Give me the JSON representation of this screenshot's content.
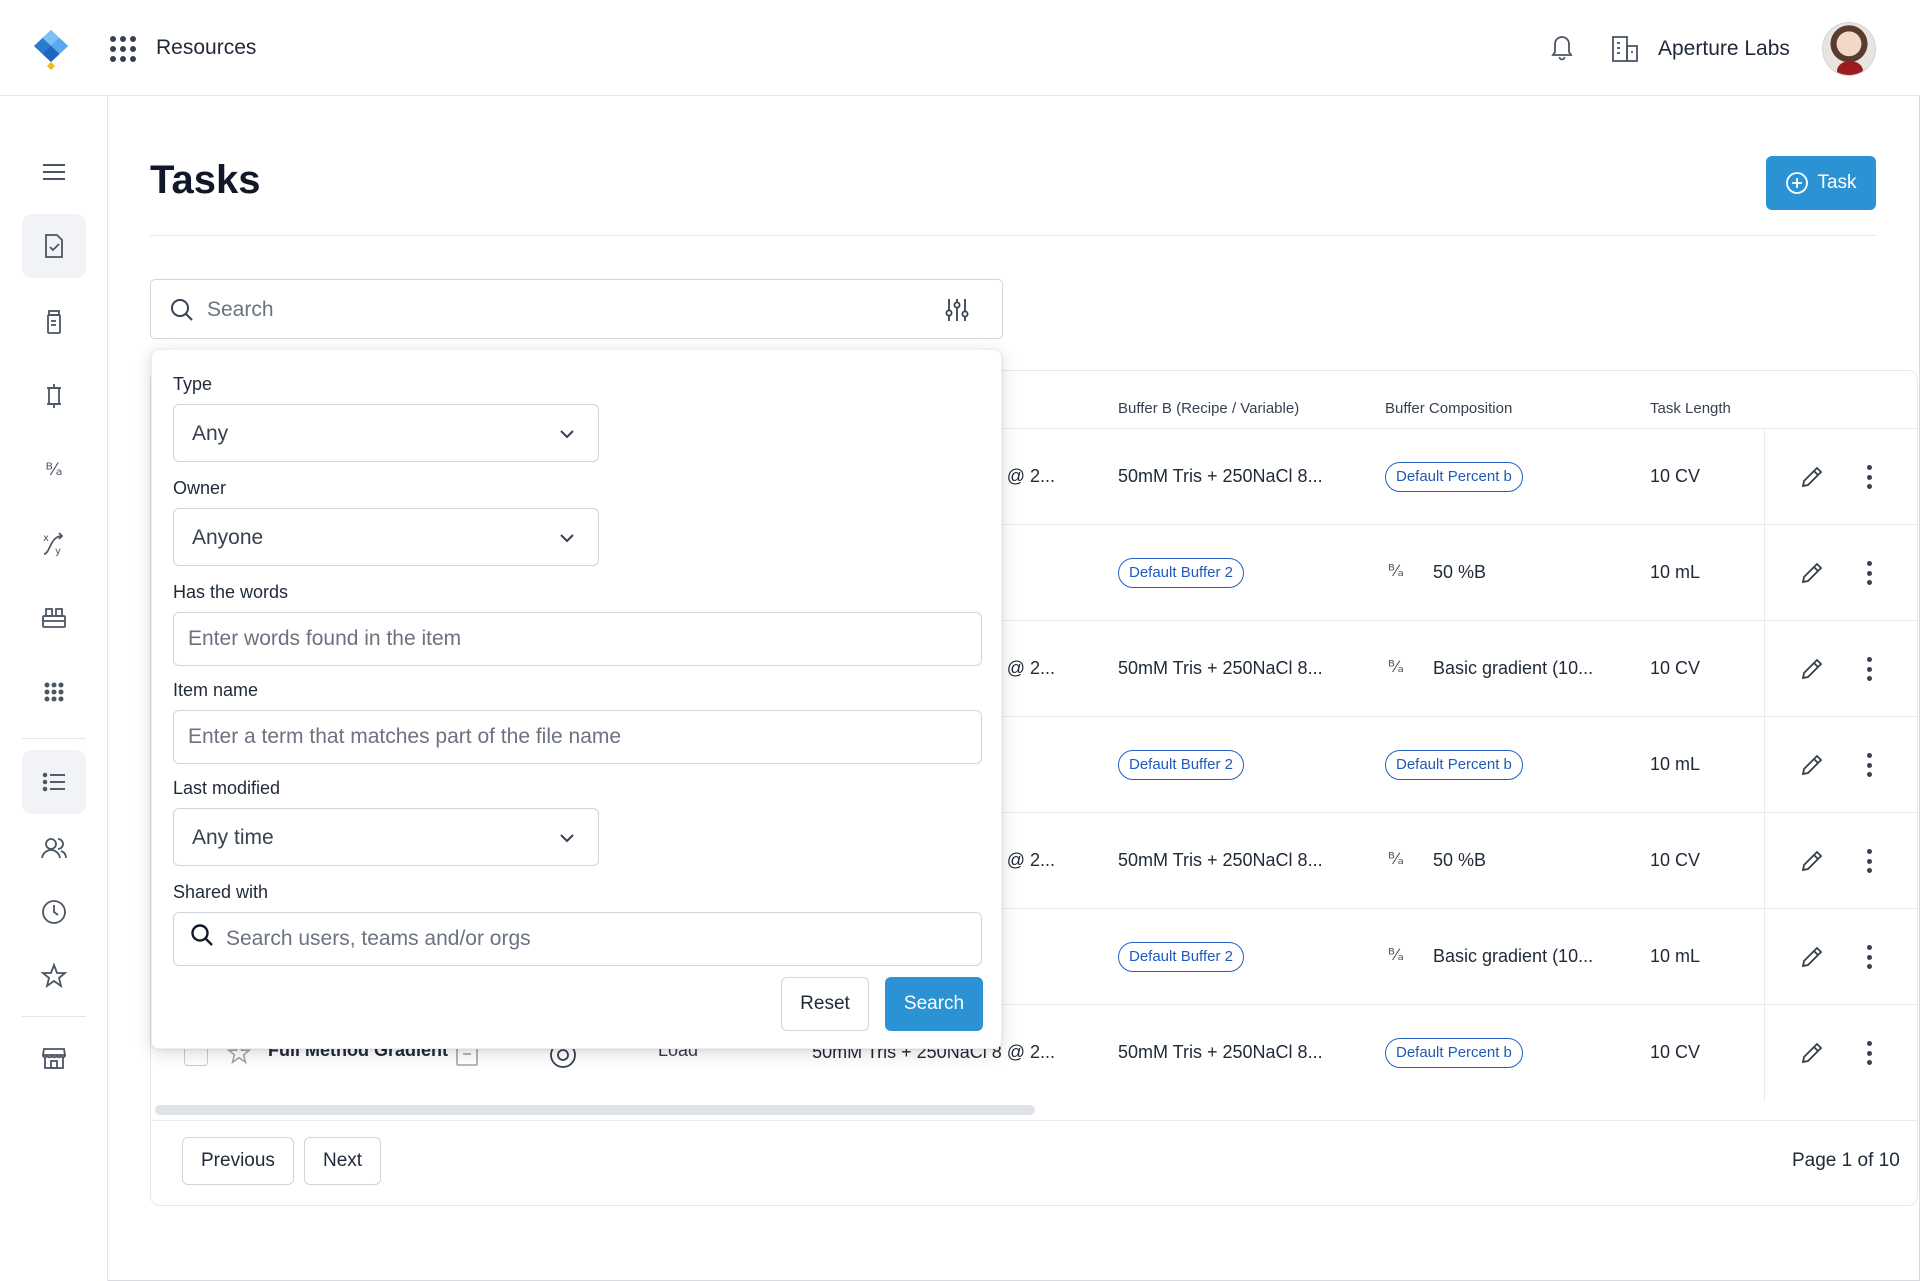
{
  "header": {
    "apps_label": "Resources",
    "org_name": "Aperture Labs"
  },
  "page": {
    "title": "Tasks",
    "new_task_label": "Task"
  },
  "search": {
    "placeholder": "Search"
  },
  "table": {
    "partial_header_fragment": ")",
    "columns": [
      "Buffer B (Recipe / Variable)",
      "Buffer Composition",
      "Task Length"
    ],
    "rows": [
      {
        "buffer_a_fragment": "8 @ 2...",
        "buffer_b": "50mM Tris + 250NaCl 8...",
        "buffer_b_is_pill": false,
        "composition": "Default Percent b",
        "composition_is_pill": true,
        "length": "10 CV"
      },
      {
        "buffer_a_fragment": "",
        "buffer_b": "Default Buffer 2",
        "buffer_b_is_pill": true,
        "composition": "50 %B",
        "composition_is_pill": false,
        "length": "10 mL"
      },
      {
        "buffer_a_fragment": "8 @ 2...",
        "buffer_b": "50mM Tris + 250NaCl 8...",
        "buffer_b_is_pill": false,
        "composition": "Basic gradient (10...",
        "composition_is_pill": false,
        "length": "10 CV"
      },
      {
        "buffer_a_fragment": "",
        "buffer_b": "Default Buffer 2",
        "buffer_b_is_pill": true,
        "composition": "Default Percent b",
        "composition_is_pill": true,
        "length": "10 mL"
      },
      {
        "buffer_a_fragment": "8 @ 2...",
        "buffer_b": "50mM Tris + 250NaCl 8...",
        "buffer_b_is_pill": false,
        "composition": "50 %B",
        "composition_is_pill": false,
        "length": "10 CV"
      },
      {
        "buffer_a_fragment": "",
        "buffer_b": "Default Buffer 2",
        "buffer_b_is_pill": true,
        "composition": "Basic gradient (10...",
        "composition_is_pill": false,
        "length": "10 mL"
      },
      {
        "buffer_a_fragment": "50mM Tris + 250NaCl 8 @ 2...",
        "buffer_b": "50mM Tris + 250NaCl 8...",
        "buffer_b_is_pill": false,
        "composition": "Default Percent b",
        "composition_is_pill": true,
        "length": "10 CV"
      }
    ],
    "hidden_row": {
      "name": "Full Method Gradient",
      "type": "Load"
    },
    "ba_glyph": "B/A"
  },
  "pagination": {
    "previous_label": "Previous",
    "next_label": "Next",
    "page_info": "Page 1 of 10"
  },
  "filter": {
    "type_label": "Type",
    "type_value": "Any",
    "owner_label": "Owner",
    "owner_value": "Anyone",
    "words_label": "Has the words",
    "words_placeholder": "Enter words found in the item",
    "name_label": "Item name",
    "name_placeholder": "Enter a term that matches part of the file name",
    "modified_label": "Last modified",
    "modified_value": "Any time",
    "shared_label": "Shared with",
    "shared_placeholder": "Search users, teams and/or orgs",
    "reset_label": "Reset",
    "search_label": "Search"
  },
  "colors": {
    "accent": "#2b93d3",
    "pill_border": "#1e63c4"
  }
}
